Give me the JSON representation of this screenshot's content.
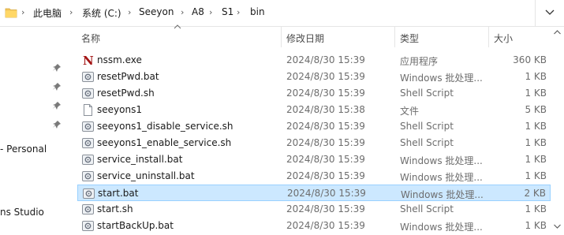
{
  "address": {
    "crumbs": [
      "此电脑",
      "系统 (C:)",
      "Seeyon",
      "A8",
      "S1",
      "bin"
    ]
  },
  "nav": {
    "labels": [
      "- Personal",
      "ns Studio"
    ]
  },
  "columns": {
    "name": "名称",
    "date": "修改日期",
    "type": "类型",
    "size": "大小"
  },
  "files": [
    {
      "name": "nssm.exe",
      "date": "2024/8/30 15:39",
      "type": "应用程序",
      "size": "360 KB",
      "icon": "nssm-exe-icon"
    },
    {
      "name": "resetPwd.bat",
      "date": "2024/8/30 15:39",
      "type": "Windows 批处理...",
      "size": "1 KB",
      "icon": "batch-file-icon"
    },
    {
      "name": "resetPwd.sh",
      "date": "2024/8/30 15:39",
      "type": "Shell Script",
      "size": "1 KB",
      "icon": "shell-script-icon"
    },
    {
      "name": "seeyons1",
      "date": "2024/8/30 15:38",
      "type": "文件",
      "size": "5 KB",
      "icon": "file-icon"
    },
    {
      "name": "seeyons1_disable_service.sh",
      "date": "2024/8/30 15:39",
      "type": "Shell Script",
      "size": "1 KB",
      "icon": "shell-script-icon"
    },
    {
      "name": "seeyons1_enable_service.sh",
      "date": "2024/8/30 15:39",
      "type": "Shell Script",
      "size": "1 KB",
      "icon": "shell-script-icon"
    },
    {
      "name": "service_install.bat",
      "date": "2024/8/30 15:39",
      "type": "Windows 批处理...",
      "size": "1 KB",
      "icon": "batch-file-icon"
    },
    {
      "name": "service_uninstall.bat",
      "date": "2024/8/30 15:39",
      "type": "Windows 批处理...",
      "size": "1 KB",
      "icon": "batch-file-icon"
    },
    {
      "name": "start.bat",
      "date": "2024/8/30 15:39",
      "type": "Windows 批处理...",
      "size": "2 KB",
      "icon": "batch-file-icon",
      "selected": true
    },
    {
      "name": "start.sh",
      "date": "2024/8/30 15:39",
      "type": "Shell Script",
      "size": "1 KB",
      "icon": "shell-script-icon"
    },
    {
      "name": "startBackUp.bat",
      "date": "2024/8/30 15:39",
      "type": "Windows 批处理...",
      "size": "1 KB",
      "icon": "batch-file-icon"
    }
  ],
  "colors": {
    "selection_bg": "#cce8ff",
    "selection_border": "#99d1ff",
    "nssm_red": "#a31515"
  }
}
